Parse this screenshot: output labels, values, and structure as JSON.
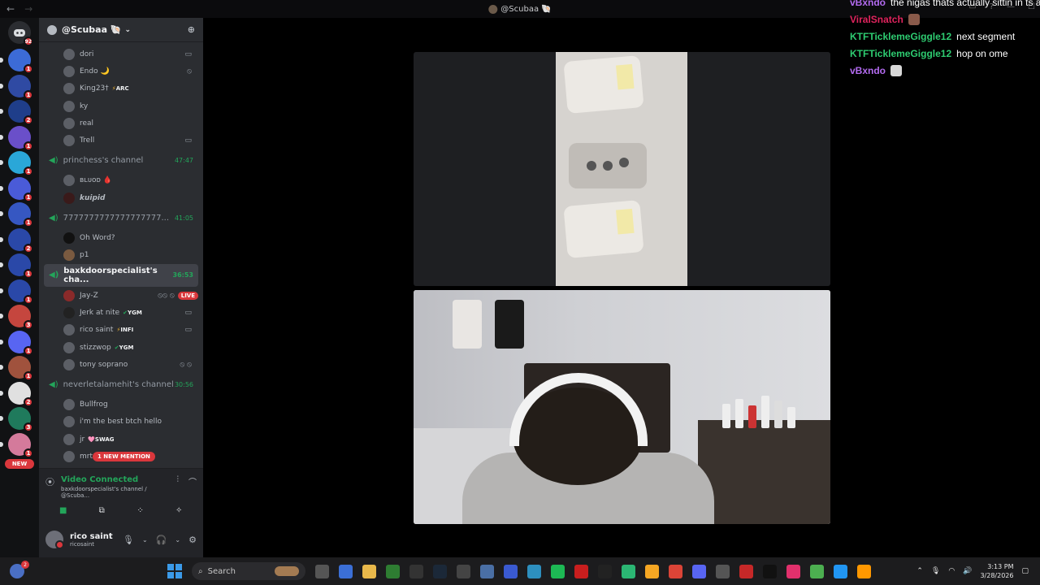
{
  "window": {
    "back_glyph": "←",
    "forward_glyph": "→",
    "title": "@Scubaa 🐚"
  },
  "chat_overlay": [
    {
      "name": "vBxndo",
      "color": "#b36bf0",
      "message": "the nigas thats actually sittin in ts ac"
    },
    {
      "name": "ViralSnatch",
      "color": "#e0245e",
      "message": ""
    },
    {
      "name": "KTFTicklemeGiggle12",
      "color": "#2ecc71",
      "message": "next segment"
    },
    {
      "name": "KTFTicklemeGiggle12",
      "color": "#2ecc71",
      "message": "hop on ome"
    },
    {
      "name": "vBxndo",
      "color": "#b36bf0",
      "message": ""
    }
  ],
  "servers": {
    "home_badge": "92",
    "items": [
      {
        "badge": "1",
        "color": "#3c6bd6"
      },
      {
        "badge": "1",
        "color": "#2f4aa3"
      },
      {
        "badge": "2",
        "color": "#1f3e8a"
      },
      {
        "badge": "1",
        "color": "#6a4fc9"
      },
      {
        "badge": "1",
        "color": "#2aa7d8"
      },
      {
        "badge": "1",
        "color": "#4a5bd8"
      },
      {
        "badge": "1",
        "color": "#3657c2"
      },
      {
        "badge": "2",
        "color": "#2a48a8"
      },
      {
        "badge": "1",
        "color": "#2a48a8"
      },
      {
        "badge": "1",
        "color": "#2a48a8"
      },
      {
        "badge": "3",
        "color": "#c5463e"
      },
      {
        "badge": "1",
        "color": "#5865f2"
      },
      {
        "badge": "1",
        "color": "#a0523d"
      },
      {
        "badge": "2",
        "color": "#e0e0e0"
      },
      {
        "badge": "3",
        "color": "#1f7a5c"
      },
      {
        "badge": "1",
        "color": "#d47a9b"
      },
      {
        "badge": "",
        "color": "#111214"
      }
    ],
    "new_label": "NEW"
  },
  "guild": {
    "name": "@Scubaa 🐚"
  },
  "channel_list": {
    "top_users": [
      {
        "name": "dori",
        "right": "▭"
      },
      {
        "name": "Endo 🌙",
        "right": "⦸"
      },
      {
        "name": "King23†",
        "tag": "ARC",
        "tag_icon": "⚡",
        "right": ""
      },
      {
        "name": "ky",
        "right": ""
      },
      {
        "name": "real",
        "right": ""
      },
      {
        "name": "Trell",
        "right": "▭"
      }
    ],
    "vc1": {
      "name": "princhess's channel",
      "timer": "47:47"
    },
    "vc1_users": [
      {
        "name": "ʙʟᴜᴏᴅ 🩸"
      },
      {
        "name": "kuipid"
      }
    ],
    "vc2": {
      "name": "7777777777777777777...",
      "timer": "41:05"
    },
    "vc2_users": [
      {
        "name": "Oh Word?"
      },
      {
        "name": "p1"
      }
    ],
    "vc3": {
      "name": "baxkdoorspecialist's cha...",
      "timer": "36:53"
    },
    "vc3_users": [
      {
        "name": "Jay-Z",
        "icons": "⦸⦸ ⦸",
        "live": "LIVE"
      },
      {
        "name": "Jerk at nite",
        "tag": "YGM",
        "tag_icon": "✔",
        "right": "▭"
      },
      {
        "name": "rico saint",
        "tag": "INFI",
        "tag_icon": "⚡",
        "right": "▭"
      },
      {
        "name": "stizzwop",
        "tag": "YGM",
        "tag_icon": "✔"
      },
      {
        "name": "tony soprano",
        "right": "⦸ ⦸"
      }
    ],
    "vc4": {
      "name": "neverletalamehit's channel",
      "timer": "30:56"
    },
    "vc4_users": [
      {
        "name": "Bullfrog"
      },
      {
        "name": "i'm the best btch hello"
      },
      {
        "name": "jr",
        "tag": "SWAG",
        "tag_icon": "🩷"
      },
      {
        "name": "mrt",
        "mention": "1 NEW MENTION"
      }
    ]
  },
  "voice_panel": {
    "status": "Video Connected",
    "location": "baxkdoorspecialist's channel / @Scuba...",
    "user_name": "rico saint",
    "user_handle": "ricosaint"
  },
  "taskbar": {
    "weather_badge": "2",
    "search_placeholder": "Search",
    "time": "3:13 PM",
    "date": "3/28/2026"
  },
  "colors": {
    "green": "#23a55a",
    "red": "#da373c",
    "bg_channels": "#2b2d31",
    "bg_servers": "#111214"
  }
}
